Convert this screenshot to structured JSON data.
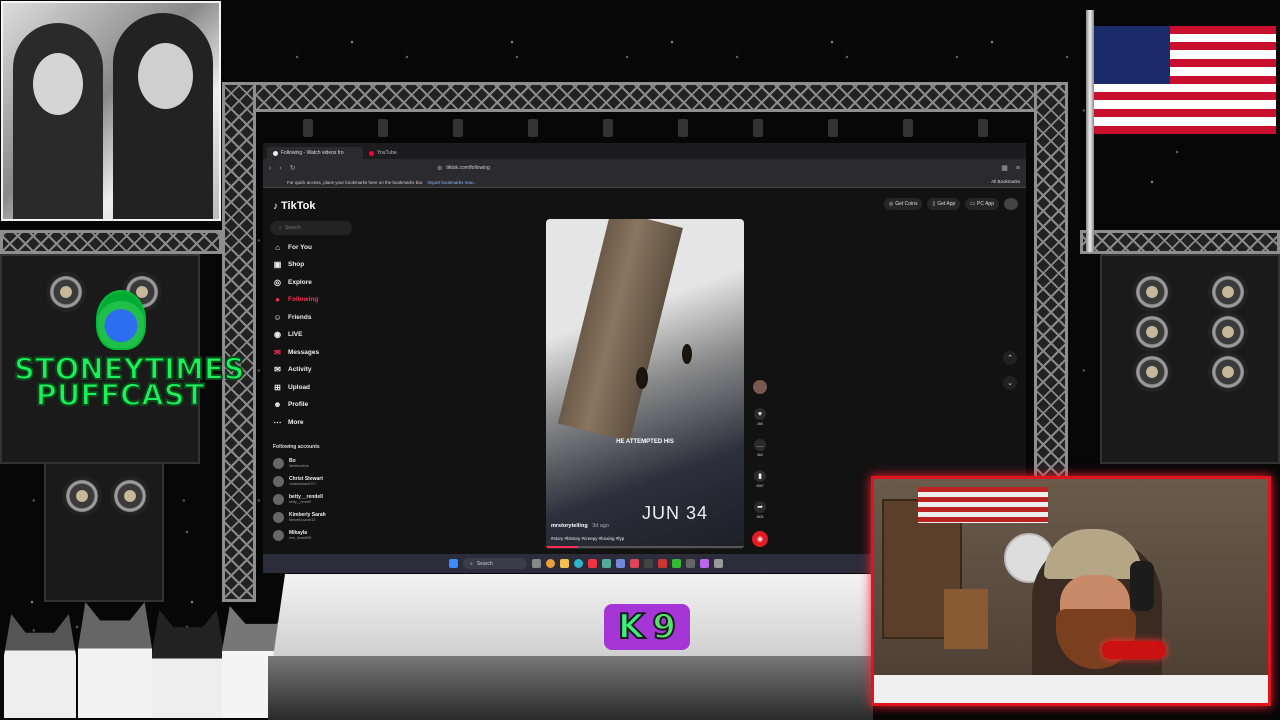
{
  "browser": {
    "tabs": [
      {
        "label": "Following - Watch videos fro",
        "active": true
      },
      {
        "label": "YouTube",
        "active": false
      }
    ],
    "url": "tiktok.com/following",
    "bookmarks_message": "For quick access, place your bookmarks here on the bookmarks bar.",
    "bookmarks_link": "Import bookmarks now...",
    "all_bookmarks": "All Bookmarks"
  },
  "tiktok": {
    "logo": "TikTok",
    "search_placeholder": "Search",
    "nav": [
      {
        "label": "For You",
        "icon": "home-icon",
        "active": false
      },
      {
        "label": "Shop",
        "icon": "shop-icon",
        "active": false
      },
      {
        "label": "Explore",
        "icon": "compass-icon",
        "active": false
      },
      {
        "label": "Following",
        "icon": "people-icon",
        "active": true
      },
      {
        "label": "Friends",
        "icon": "friends-icon",
        "active": false
      },
      {
        "label": "LIVE",
        "icon": "live-icon",
        "active": false
      },
      {
        "label": "Messages",
        "icon": "messages-icon",
        "active": false
      },
      {
        "label": "Activity",
        "icon": "activity-icon",
        "active": false
      },
      {
        "label": "Upload",
        "icon": "upload-icon",
        "active": false
      },
      {
        "label": "Profile",
        "icon": "profile-icon",
        "active": false
      },
      {
        "label": "More",
        "icon": "more-icon",
        "active": false
      }
    ],
    "following_title": "Following accounts",
    "accounts": [
      {
        "name": "Bo",
        "handle": "itsbeboxthoe"
      },
      {
        "name": "Christ Stewart",
        "handle": "christstewart1377"
      },
      {
        "name": "betty__rendell",
        "handle": "betty__rendell"
      },
      {
        "name": "Kimberly Sarah",
        "handle": "kimberly.sarah15"
      },
      {
        "name": "Mikayla",
        "handle": "tree_beast999"
      }
    ],
    "top_actions": [
      {
        "label": "Get Coins",
        "icon": "coin-icon"
      },
      {
        "label": "Get App",
        "icon": "phone-icon"
      },
      {
        "label": "PC App",
        "icon": "monitor-icon"
      }
    ],
    "video": {
      "caption": "HE ATTEMPTED HIS",
      "overlay_text": "JUN 34",
      "author": "mrstorytelling",
      "age": "3d ago",
      "hashtags": "#story #history #creepy #boxing #fyp"
    },
    "actions": {
      "likes": "26K",
      "comments": "464",
      "saves": "4967",
      "shares": "1831"
    }
  },
  "taskbar": {
    "search_label": "Search"
  },
  "overlay": {
    "brand_line1": "STONEYTIMES",
    "brand_line2": "PUFFCAST",
    "badge_k": "K",
    "badge_num": "9"
  }
}
